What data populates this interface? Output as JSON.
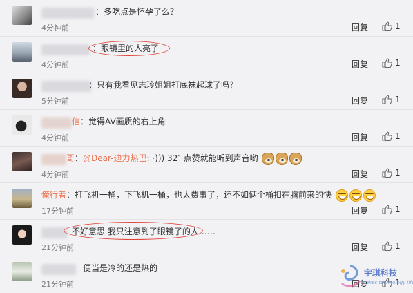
{
  "comments": [
    {
      "text": "：多吃点是怀孕了么？",
      "time": "4分钟前",
      "reply": "回复",
      "likes": "1"
    },
    {
      "text": "：眼镜里的人亮了",
      "time": "4分钟前",
      "reply": "回复",
      "likes": "1"
    },
    {
      "text": "：只有我看见志玲姐姐打底袜起球了吗？",
      "time": "5分钟前",
      "reply": "回复",
      "likes": "1"
    },
    {
      "name_tail": "信",
      "text": "：觉得AV画质的右上角",
      "time": "4分钟前",
      "reply": "回复",
      "likes": "1"
    },
    {
      "name_tail": "哥",
      "text_pre": "：",
      "mention": "@Dear-迪力热巴",
      "text": ": ·)))       32″  点赞就能听到声音哟",
      "time": "4分钟前",
      "reply": "回复",
      "likes": "1"
    },
    {
      "name": "俺行者",
      "text": "：打飞机一桶，下飞机一桶，也太费事了，还不如俩个桶扣在胸前来的快",
      "time": "17分钟前",
      "reply": "回复",
      "likes": "1"
    },
    {
      "text": "不好意思 我只注意到了眼镜了的人……",
      "time": "21分钟前",
      "reply": "回复",
      "likes": "1"
    },
    {
      "text": "便当是冷的还是热的",
      "time": "21分钟前",
      "reply": "回复",
      "likes": "1"
    }
  ],
  "watermark": {
    "text": "宇琪科技",
    "subtext": "makes technology life"
  },
  "colors": {
    "accent": "#eb7350",
    "highlight_circle": "#e0443a",
    "background": "#f2f2f5"
  }
}
